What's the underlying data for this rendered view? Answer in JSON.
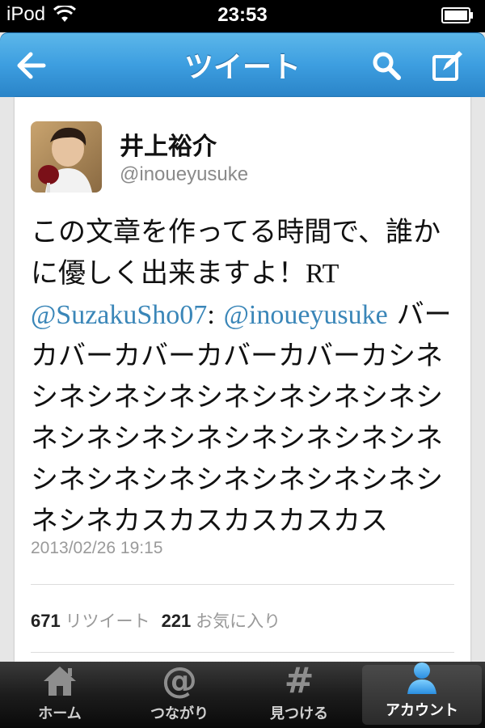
{
  "status_bar": {
    "carrier": "iPod",
    "time": "23:53"
  },
  "nav": {
    "title": "ツイート"
  },
  "tweet": {
    "author_name": "井上裕介",
    "author_handle": "@inoueyusuke",
    "text_line1": "この文章を作ってる時間で、誰かに優しく出来ますよ！",
    "rt": "RT",
    "mention1": "@SuzakuSho07",
    "colon": ":",
    "mention2": "@inoueyusuke",
    "text_rest": "バーカバーカバーカバーカバーカシネシネシネシネシネシネシネシネシネシネシネシネシネシネシネシネシネシネシネシネシネシネシネシネシネカスカスカスカスカス",
    "timestamp": "2013/02/26 19:15",
    "retweet_count": "671",
    "retweet_label": "リツイート",
    "favorite_count": "221",
    "favorite_label": "お気に入り"
  },
  "tabs": [
    {
      "label": "ホーム",
      "icon": "home-icon"
    },
    {
      "label": "つながり",
      "icon": "at-icon"
    },
    {
      "label": "見つける",
      "icon": "hash-icon"
    },
    {
      "label": "アカウント",
      "icon": "person-icon"
    }
  ],
  "colors": {
    "nav_blue": "#3d9ee0",
    "link_blue": "#3a86b8"
  }
}
